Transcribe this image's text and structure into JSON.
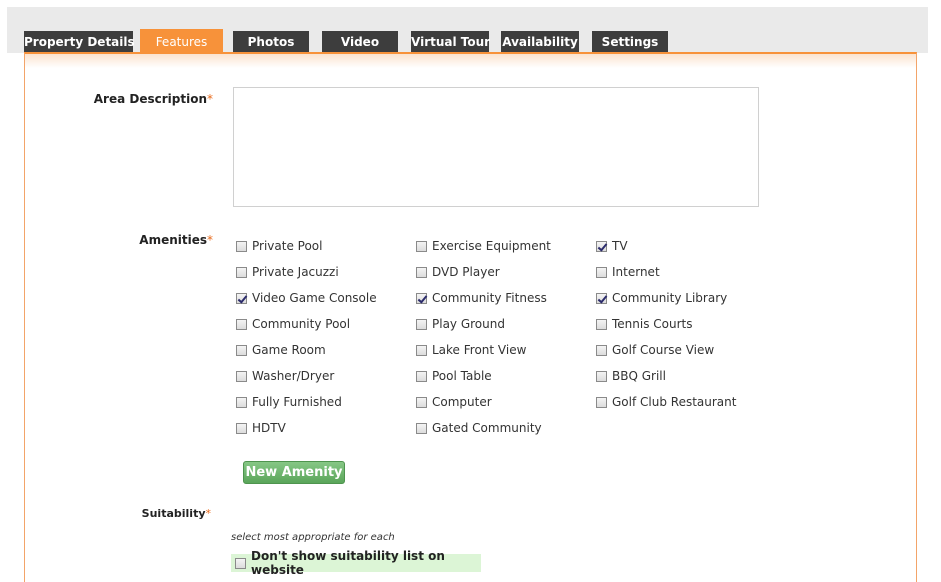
{
  "tabs": [
    {
      "label": "Property Details",
      "active": false
    },
    {
      "label": "Features",
      "active": true
    },
    {
      "label": "Photos",
      "active": false
    },
    {
      "label": "Video",
      "active": false
    },
    {
      "label": "Virtual Tour",
      "active": false
    },
    {
      "label": "Availability",
      "active": false
    },
    {
      "label": "Settings",
      "active": false
    }
  ],
  "form": {
    "area_description": {
      "label": "Area Description",
      "required_mark": "*",
      "value": ""
    },
    "amenities": {
      "label": "Amenities",
      "required_mark": "*",
      "items": [
        {
          "label": "Private Pool",
          "checked": false
        },
        {
          "label": "Exercise Equipment",
          "checked": false
        },
        {
          "label": "TV",
          "checked": true
        },
        {
          "label": "Private Jacuzzi",
          "checked": false
        },
        {
          "label": "DVD Player",
          "checked": false
        },
        {
          "label": "Internet",
          "checked": false
        },
        {
          "label": "Video Game Console",
          "checked": true
        },
        {
          "label": "Community Fitness",
          "checked": true
        },
        {
          "label": "Community Library",
          "checked": true
        },
        {
          "label": "Community Pool",
          "checked": false
        },
        {
          "label": "Play Ground",
          "checked": false
        },
        {
          "label": "Tennis Courts",
          "checked": false
        },
        {
          "label": "Game Room",
          "checked": false
        },
        {
          "label": "Lake Front View",
          "checked": false
        },
        {
          "label": "Golf Course View",
          "checked": false
        },
        {
          "label": "Washer/Dryer",
          "checked": false
        },
        {
          "label": "Pool Table",
          "checked": false
        },
        {
          "label": "BBQ Grill",
          "checked": false
        },
        {
          "label": "Fully Furnished",
          "checked": false
        },
        {
          "label": "Computer",
          "checked": false
        },
        {
          "label": "Golf Club Restaurant",
          "checked": false
        },
        {
          "label": "HDTV",
          "checked": false
        },
        {
          "label": "Gated Community",
          "checked": false
        }
      ],
      "new_button_label": "New Amenity"
    },
    "suitability": {
      "label": "Suitability",
      "required_mark": "*",
      "hint": "select most appropriate for each",
      "dont_show": {
        "label": "Don't show suitability list on website",
        "checked": false
      }
    }
  },
  "colors": {
    "tab_active": "#f7923a",
    "tab_inactive": "#3d3d3d",
    "required": "#e86a1c",
    "button_green": "#5aa55a"
  }
}
